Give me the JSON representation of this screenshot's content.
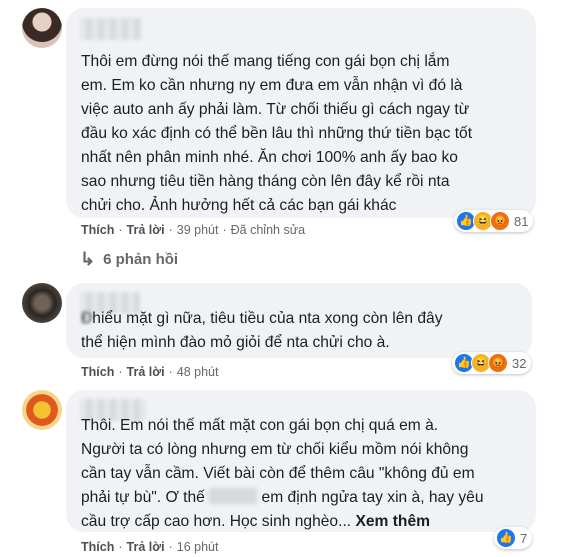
{
  "comments": [
    {
      "text": "Thôi em đừng nói thế mang tiếng con gái bọn chị lắm\nem. Em ko cần nhưng ny em đưa em vẫn nhận vì đó là\nviệc auto anh ấy phải làm. Từ chối thiếu gì cách ngay từ\nđầu ko xác định có thể bền lâu thì những thứ tiền bạc tốt\nnhất nên phân minh nhé. Ăn chơi 100% anh ấy bao ko\nsao nhưng tiêu tiền hàng tháng còn lên đây kể rồi nta\nchửi cho. Ảnh hưởng hết cả các bạn gái khác",
      "like_label": "Thích",
      "reply_label": "Trả lời",
      "time": "39 phút",
      "edited": "Đã chỉnh sửa",
      "reaction_icons": [
        "like-icon",
        "haha-icon",
        "angry-icon"
      ],
      "reaction_count": "81"
    },
    {
      "text_prefix": "Đ",
      "text": "hiểu mặt gì nữa, tiêu tiều của nta xong còn lên đây\nthể hiện mình đào mỏ giỏi để nta chửi cho à.",
      "like_label": "Thích",
      "reply_label": "Trả lời",
      "time": "48 phút",
      "reaction_icons": [
        "like-icon",
        "haha-icon",
        "angry-icon"
      ],
      "reaction_count": "32"
    },
    {
      "text_a": "Thôi. Em nói thế mất mặt con gái bọn chị quá em à.\nNgười ta có lòng nhưng em từ chối kiểu mồm nói không\ncần tay vẫn cầm. Viết bài còn để thêm câu \"không đủ em\nphải tự bù\". Ơ thế",
      "text_b": "em định ngửa tay xin à, hay yêu\ncầu trợ cấp cao hơn. Học sinh nghèo...",
      "see_more": "Xem thêm",
      "like_label": "Thích",
      "reply_label": "Trả lời",
      "time": "16 phút",
      "reaction_icons": [
        "like-icon"
      ],
      "reaction_count": "7"
    }
  ],
  "replies_toggle": "6 phản hồi",
  "colors": {
    "like": "#1877f2",
    "haha": "#f7b125",
    "angry": "#e9710f",
    "bubble": "#f0f2f5"
  }
}
